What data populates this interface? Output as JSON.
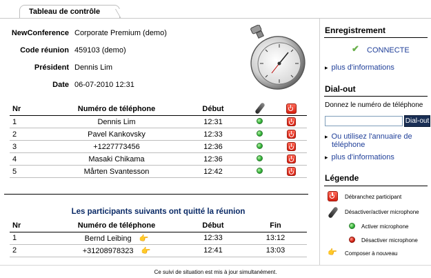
{
  "tab": {
    "label": "Tableau de contrôle"
  },
  "info": [
    {
      "label": "NewConference",
      "value": "Corporate Premium (demo)"
    },
    {
      "label": "Code réunion",
      "value": "459103 (demo)"
    },
    {
      "label": "Président",
      "value": "Dennis Lim"
    },
    {
      "label": "Date",
      "value": "06-07-2010 12:31"
    }
  ],
  "active_table": {
    "headers": {
      "nr": "Nr",
      "phone": "Numéro de téléphone",
      "start": "Début"
    },
    "rows": [
      {
        "nr": "1",
        "phone": "Dennis Lim",
        "start": "12:31"
      },
      {
        "nr": "2",
        "phone": "Pavel Kankovsky",
        "start": "12:33"
      },
      {
        "nr": "3",
        "phone": "+1227773456",
        "start": "12:36"
      },
      {
        "nr": "4",
        "phone": "Masaki Chikama",
        "start": "12:36"
      },
      {
        "nr": "5",
        "phone": "Mårten Svantesson",
        "start": "12:42"
      }
    ]
  },
  "left_section": {
    "title": "Les participants suivants ont quitté la réunion",
    "headers": {
      "nr": "Nr",
      "phone": "Numéro de téléphone",
      "start": "Début",
      "end": "Fin"
    },
    "rows": [
      {
        "nr": "1",
        "phone": "Bernd Leibing",
        "start": "12:33",
        "end": "13:12"
      },
      {
        "nr": "2",
        "phone": "+31208978323",
        "start": "12:41",
        "end": "13:03"
      }
    ]
  },
  "footer": "Ce suivi de situation est mis à jour simultanément.",
  "panel": {
    "recording": {
      "title": "Enregistrement",
      "status": "CONNECTE",
      "more": "plus d'informations"
    },
    "dialout": {
      "title": "Dial-out",
      "prompt": "Donnez le numéro de téléphone",
      "input_value": "",
      "button": "Dial-out",
      "directory_link": "Ou utilisez l'annuaire de téléphone",
      "more": "plus d'informations"
    },
    "legend": {
      "title": "Légende",
      "items": [
        "Débranchez participant",
        "Désactiver/activer microphone",
        "Activer microphone",
        "Désactiver microphone",
        "Composer à nouveau"
      ]
    }
  },
  "colors": {
    "accent_link": "#1f3f99",
    "dial_button": "#1a2f55",
    "check": "#6ab04c",
    "status_green": "#35b53a",
    "status_red": "#d61f10"
  }
}
